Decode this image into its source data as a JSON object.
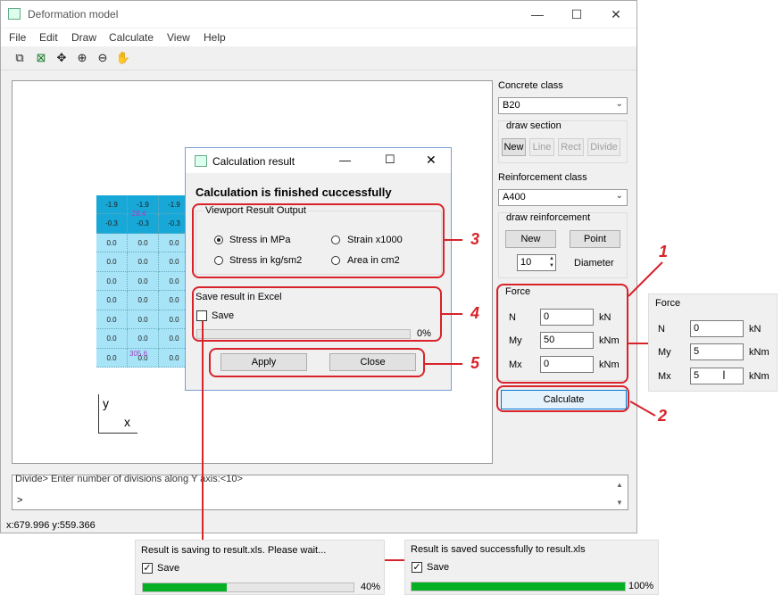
{
  "window": {
    "title": "Deformation model",
    "minimize": "—",
    "maximize": "☐",
    "close": "✕"
  },
  "menu": [
    "File",
    "Edit",
    "Draw",
    "Calculate",
    "View",
    "Help"
  ],
  "toolbar": [
    "copy-icon",
    "excel-icon",
    "move-icon",
    "zoom-in-icon",
    "zoom-out-icon",
    "pan-hand-icon"
  ],
  "canvas": {
    "grid_rows": [
      [
        "-1.9",
        "-1.9",
        "-1.9"
      ],
      [
        "-0.3",
        "-0.3",
        "-0.3"
      ],
      [
        "0.0",
        "0.0",
        "0.0"
      ],
      [
        "0.0",
        "0.0",
        "0.0"
      ],
      [
        "0.0",
        "0.0",
        "0.0"
      ],
      [
        "0.0",
        "0.0",
        "0.0"
      ],
      [
        "0.0",
        "0.0",
        "0.0"
      ],
      [
        "0.0",
        "0.0",
        "0.0"
      ],
      [
        "0.0",
        "0.0",
        "0.0"
      ]
    ],
    "marker_top": "-28.4",
    "marker_bottom": "305.6",
    "axis_y": "y",
    "axis_x": "x"
  },
  "console": {
    "line1": "Divide> Enter number of divisions along Y axis:<10>",
    "line2": ">"
  },
  "status": "x:679.996 y:559.366",
  "right_panel": {
    "concrete_label": "Concrete class",
    "concrete_value": "B20",
    "draw_section_label": "draw section",
    "section_buttons": [
      "New",
      "Line",
      "Rect",
      "Divide"
    ],
    "reinforcement_label": "Reinforcement class",
    "reinforcement_value": "A400",
    "draw_reinf_label": "draw reinforcement",
    "reinf_new": "New",
    "reinf_point": "Point",
    "diameter_value": "10",
    "diameter_label": "Diameter",
    "force_label": "Force",
    "forces": [
      {
        "name": "N",
        "value": "0",
        "unit": "kN"
      },
      {
        "name": "My",
        "value": "50",
        "unit": "kNm"
      },
      {
        "name": "Mx",
        "value": "0",
        "unit": "kNm"
      }
    ],
    "calculate": "Calculate"
  },
  "force_inset": {
    "label": "Force",
    "forces": [
      {
        "name": "N",
        "value": "0",
        "unit": "kN"
      },
      {
        "name": "My",
        "value": "5",
        "unit": "kNm"
      },
      {
        "name": "Mx",
        "value": "5",
        "unit": "kNm"
      }
    ]
  },
  "dialog": {
    "title": "Calculation result",
    "heading": "Calculation is finished cuccessfully",
    "viewport_label": "Viewport Result Output",
    "options": [
      "Stress in MPa",
      "Strain x1000",
      "Stress in kg/sm2",
      "Area in cm2"
    ],
    "selected": "Stress in MPa",
    "excel_label": "Save result in Excel",
    "save_label": "Save",
    "progress_text": "0%",
    "progress": 0,
    "apply": "Apply",
    "close": "Close"
  },
  "callouts": [
    "1",
    "2",
    "3",
    "4",
    "5"
  ],
  "saving_panel": {
    "message": "Result is saving to result.xls. Please wait...",
    "save_label": "Save",
    "checked": "✓",
    "progress_text": "40%",
    "progress": 0.4
  },
  "saved_panel": {
    "message": "Result is saved successfully to result.xls",
    "save_label": "Save",
    "checked": "✓",
    "progress_text": "100%",
    "progress": 1.0
  },
  "colors": {
    "accent_red": "#d8232a",
    "progress_green": "#06b025",
    "grid_dark": "#18a8d8",
    "grid_light": "#a8e4f8"
  }
}
